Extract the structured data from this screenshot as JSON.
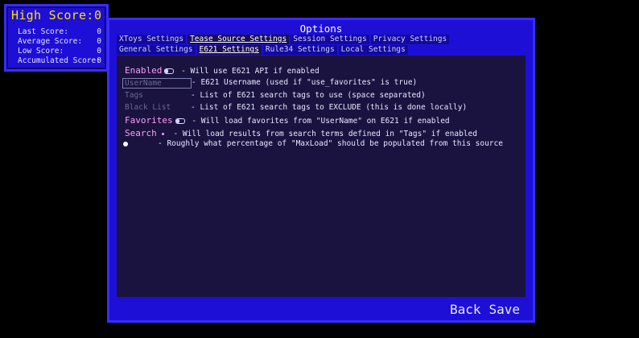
{
  "highscore": {
    "title": "High Score:",
    "value": "0",
    "rows": [
      {
        "label": "Last Score:",
        "value": "0"
      },
      {
        "label": "Average Score:",
        "value": "0"
      },
      {
        "label": "Low Score:",
        "value": "0"
      },
      {
        "label": "Accumulated Score:",
        "value": "0"
      }
    ]
  },
  "options": {
    "title": "Options",
    "tabs_row1": [
      "XToys Settings",
      "Tease Source Settings",
      "Session Settings",
      "Privacy Settings"
    ],
    "tabs_row2": [
      "General Settings",
      "E621 Settings",
      "Rule34 Settings",
      "Local Settings"
    ],
    "enabled": {
      "label": "Enabled",
      "desc": "- Will use E621 API if enabled"
    },
    "username": {
      "placeholder": "UserName",
      "desc": "- E621 Username (used if \"use_favorites\" is true)"
    },
    "tags": {
      "placeholder": "Tags",
      "desc": "- List of E621 search tags to use (space separated)"
    },
    "blacklist": {
      "placeholder": "Black List",
      "desc": "- List of E621 search tags to EXCLUDE (this is done locally)"
    },
    "favorites": {
      "label": "Favorites",
      "desc": "- Will load favorites from \"UserName\" on E621 if enabled"
    },
    "search": {
      "label": "Search",
      "desc": "- Will load results from search terms defined in \"Tags\" if enabled"
    },
    "maxload": {
      "desc": "- Roughly what percentage of \"MaxLoad\" should be populated from this source",
      "value_percent": 0
    },
    "back_label": "Back",
    "save_label": "Save"
  }
}
